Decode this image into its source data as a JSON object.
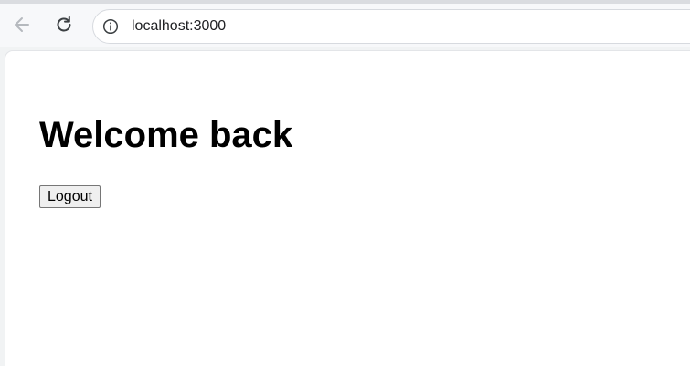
{
  "browser": {
    "address": "localhost:3000",
    "icons": {
      "back": "arrow-left-icon",
      "reload": "reload-icon",
      "site_info": "info-icon"
    }
  },
  "page": {
    "heading": "Welcome back",
    "logout_label": "Logout"
  },
  "colors": {
    "toolbar_bg": "#f7f8fa",
    "page_bg": "#ffffff",
    "text": "#000000"
  }
}
